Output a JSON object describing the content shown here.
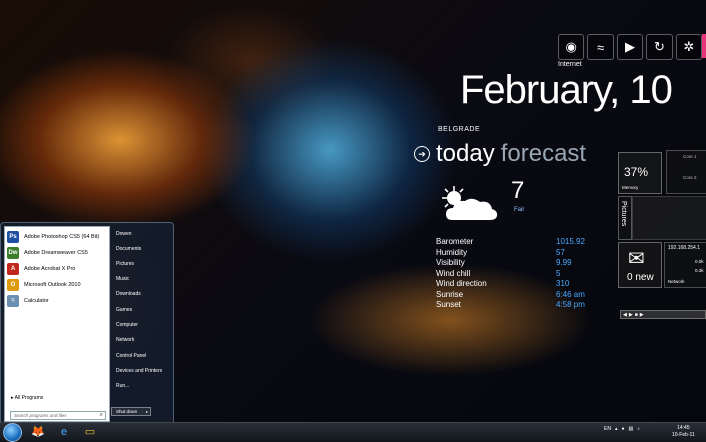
{
  "gadgets": {
    "internet_label": "Internet",
    "date": "February, 10",
    "weather": {
      "city": "BELGRADE",
      "today": "today",
      "forecast": "forecast",
      "temperature": "7",
      "condition": "Fair",
      "rows": [
        {
          "label": "Barometer",
          "value": "1015.92"
        },
        {
          "label": "Humidity",
          "value": "57"
        },
        {
          "label": "Visibility",
          "value": "9.99"
        },
        {
          "label": "Wind chill",
          "value": "5"
        },
        {
          "label": "Wind direction",
          "value": "310"
        },
        {
          "label": "Sunrise",
          "value": "6:46 am"
        },
        {
          "label": "Sunset",
          "value": "4:58 pm"
        }
      ]
    },
    "memory": {
      "percent": "37%",
      "label": "Memory"
    },
    "cores": {
      "core1": "Core 1",
      "core2": "Core 2"
    },
    "pictures_label": "Pictures",
    "mail": {
      "count": "0 new"
    },
    "network": {
      "ip": "192.168.254.1",
      "down": "0.0k",
      "up": "0.3k",
      "label": "Network"
    }
  },
  "start_menu": {
    "programs": [
      {
        "label": "Adobe Photoshop CS5 (64 Bit)",
        "icon": "Ps",
        "color": "#1f4fa3"
      },
      {
        "label": "Adobe Dreamweaver CS5",
        "icon": "Dw",
        "color": "#3a7d2a"
      },
      {
        "label": "Adobe Acrobat X Pro",
        "icon": "A",
        "color": "#c0271d"
      },
      {
        "label": "Microsoft Outlook 2010",
        "icon": "O",
        "color": "#e09a12"
      },
      {
        "label": "Calculator",
        "icon": "=",
        "color": "#6b8fb0"
      }
    ],
    "all_programs": "All Programs",
    "search_placeholder": "Search programs and files",
    "right_items": [
      "Dowen",
      "Documents",
      "Pictures",
      "Music",
      "Downloads",
      "Games",
      "Computer",
      "Network",
      "Control Panel",
      "Devices and Printers",
      "Run..."
    ],
    "shutdown": "Shut down"
  },
  "taskbar": {
    "language": "EN",
    "time": "14:45",
    "date": "10-Feb-11"
  }
}
